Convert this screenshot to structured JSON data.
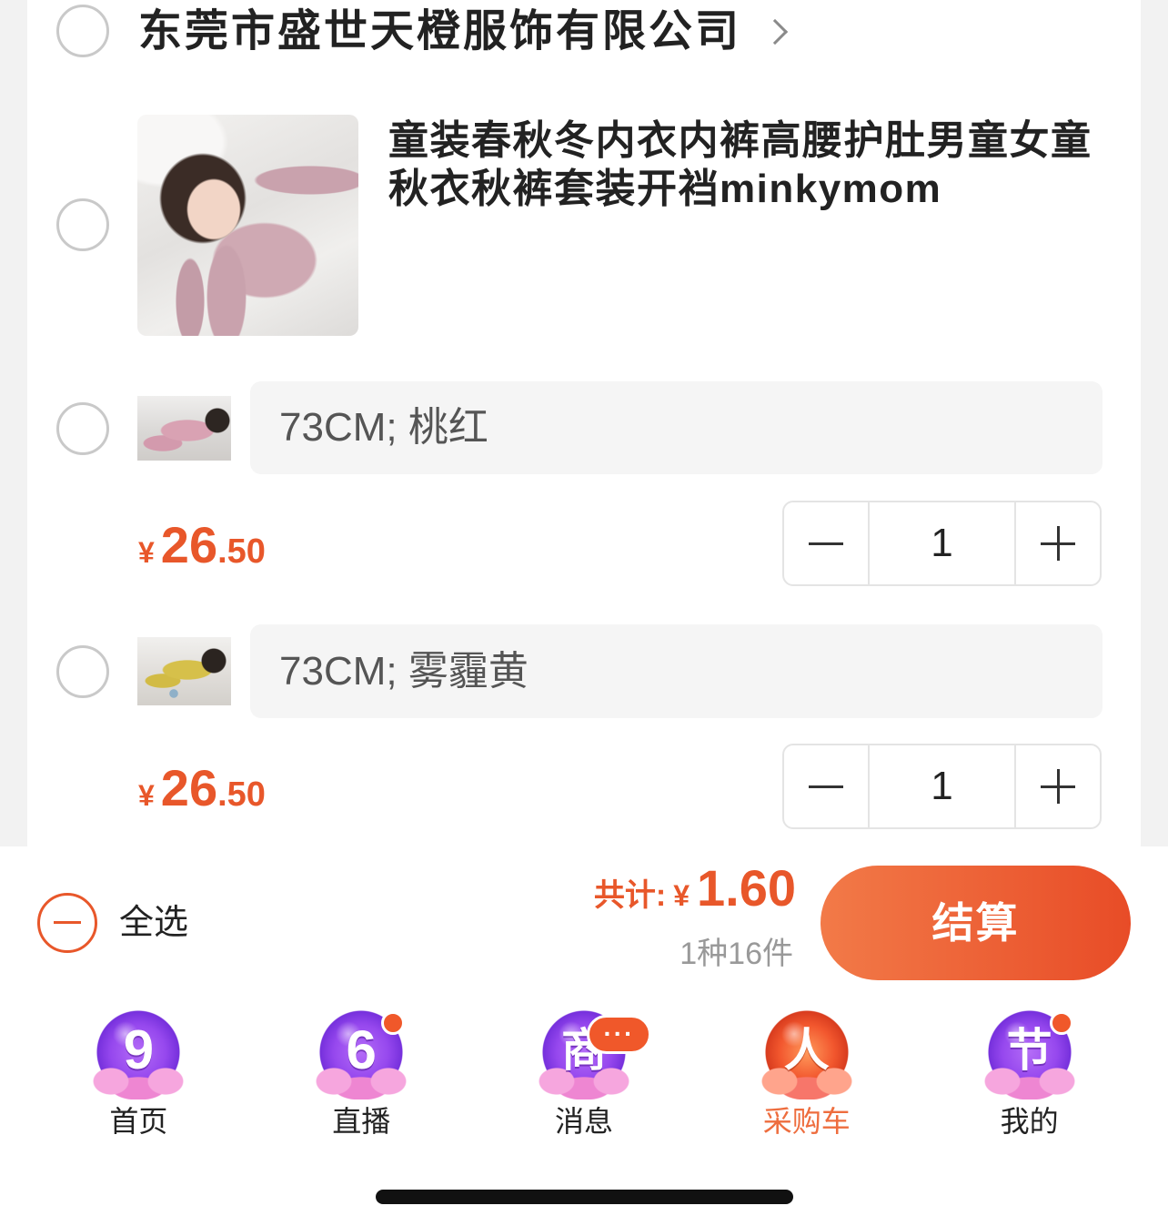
{
  "colors": {
    "accent": "#e8572a",
    "active_tab": "#ee6d3e",
    "checkout_start": "#f27a48",
    "checkout_end": "#e84c27",
    "badge": "#f0582a"
  },
  "shop": {
    "name": "东莞市盛世天橙服饰有限公司",
    "icon": "chevron-right-icon"
  },
  "product": {
    "title_lines": [
      "童装春秋冬内衣内裤高腰护肚男童女童",
      "秋衣秋裤套装开裆minkymom"
    ],
    "skus": [
      {
        "spec": "73CM; 桃红",
        "price": {
          "currency": "¥",
          "integer": "26",
          "decimal": ".50"
        },
        "quantity": 1
      },
      {
        "spec": "73CM; 雾霾黄",
        "price": {
          "currency": "¥",
          "integer": "26",
          "decimal": ".50"
        },
        "quantity": 1
      }
    ]
  },
  "footer": {
    "select_all_label": "全选",
    "total_label": "共计:",
    "total_currency": "¥",
    "total_amount": "1.60",
    "count_text": "1种16件",
    "checkout_label": "结算"
  },
  "tabs": [
    {
      "label": "首页",
      "icon": "home-badge-icon",
      "icon_glyph": "9",
      "dot_badge": false,
      "active": false
    },
    {
      "label": "直播",
      "icon": "live-badge-icon",
      "icon_glyph": "6",
      "dot_badge": true,
      "active": false
    },
    {
      "label": "消息",
      "icon": "message-badge-icon",
      "icon_glyph": "商",
      "badge_text": "···",
      "active": false
    },
    {
      "label": "采购车",
      "icon": "cart-badge-icon",
      "icon_glyph": "人",
      "active": true
    },
    {
      "label": "我的",
      "icon": "profile-badge-icon",
      "icon_glyph": "节",
      "dot_badge": true,
      "active": false
    }
  ]
}
